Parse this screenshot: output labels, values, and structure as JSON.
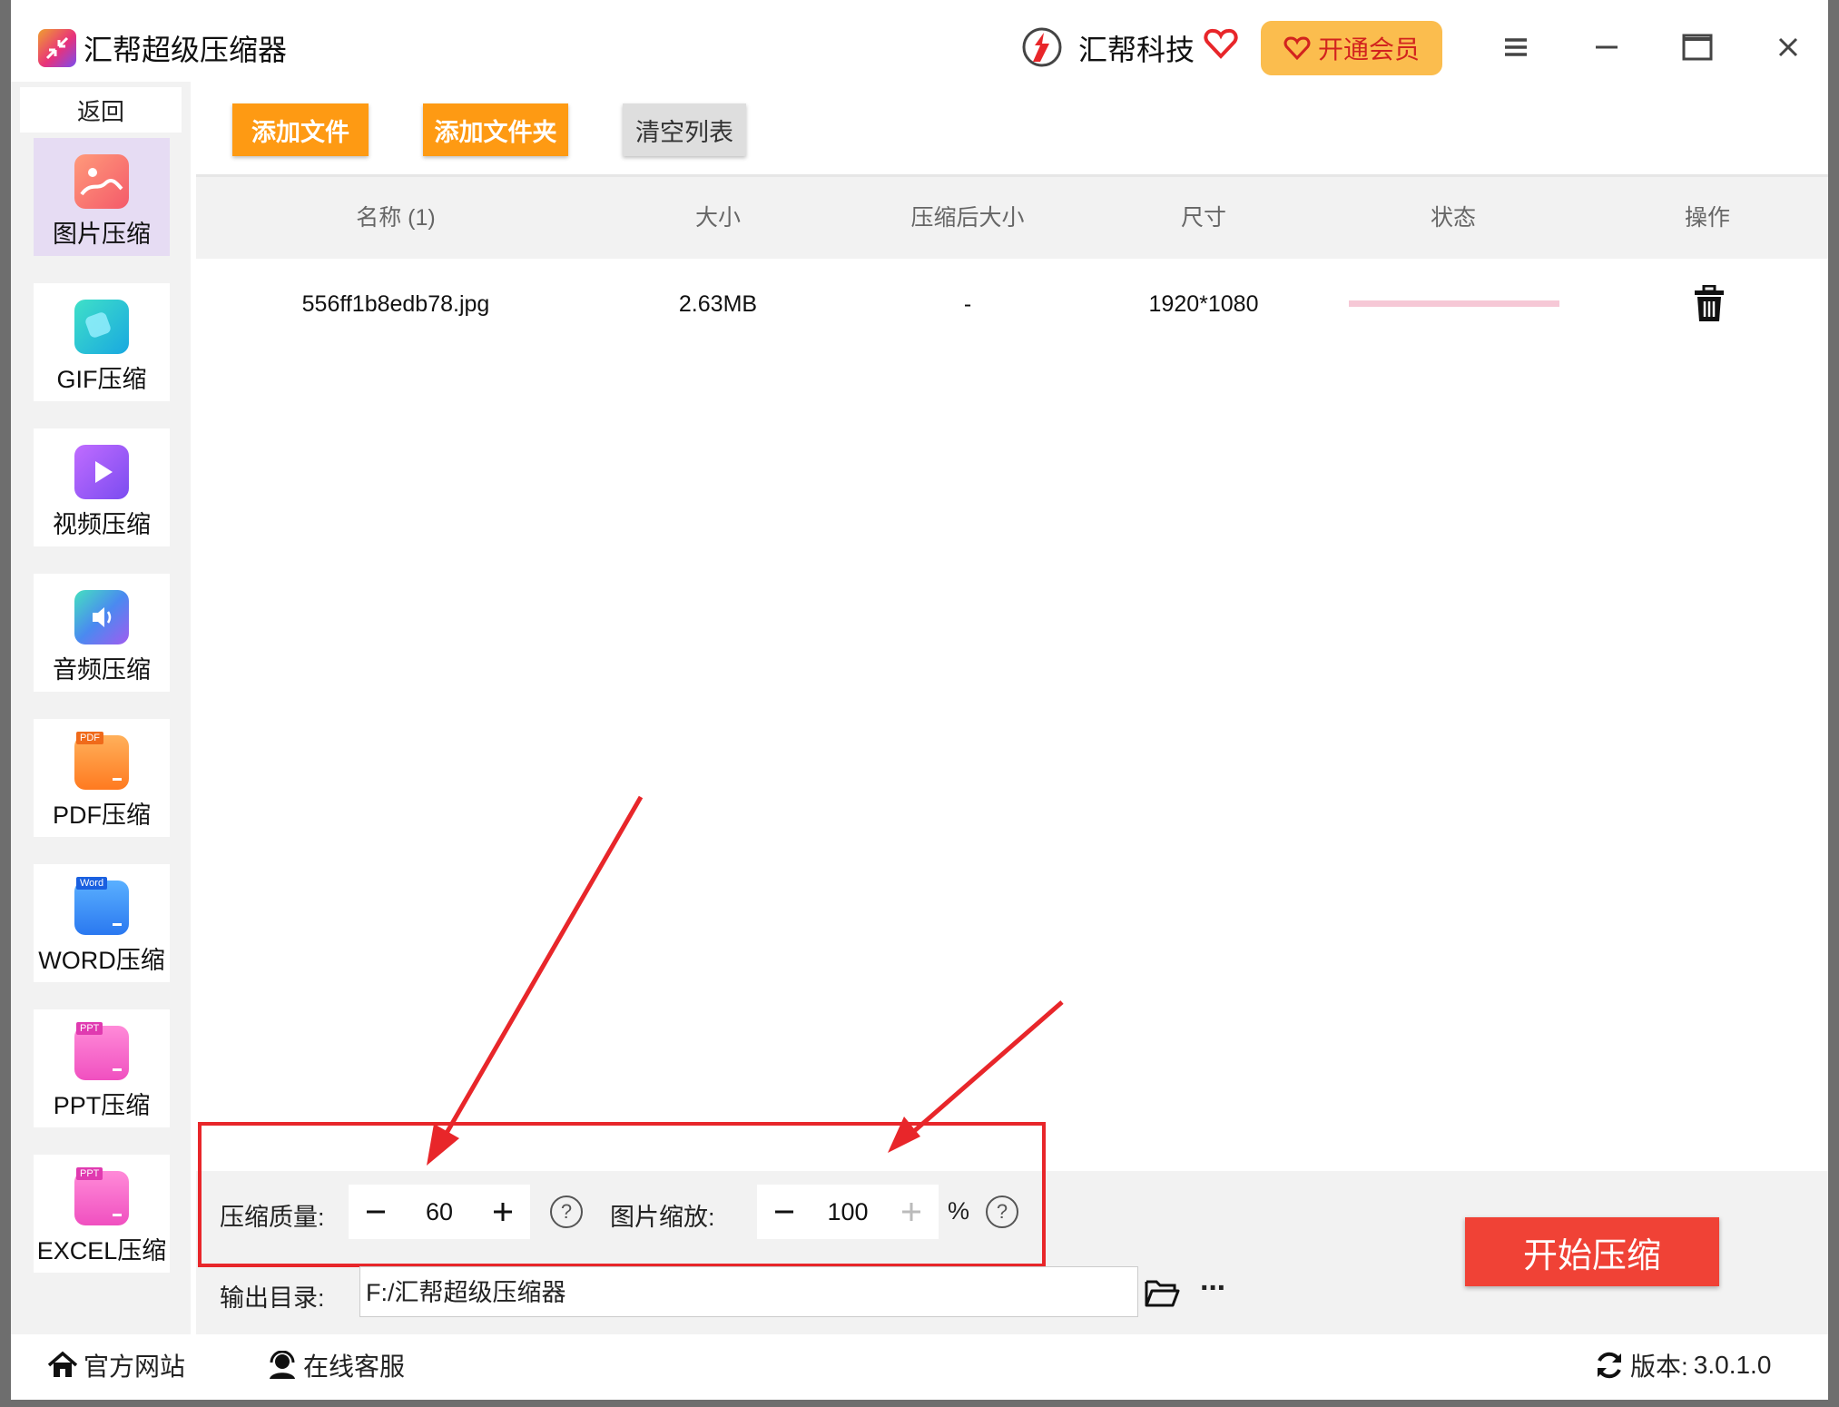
{
  "window": {
    "title": "汇帮超级压缩器",
    "brand": "汇帮科技",
    "vip_label": "开通会员"
  },
  "sidebar": {
    "back_label": "返回",
    "items": [
      {
        "label": "图片压缩",
        "icon": "image-icon",
        "active": true
      },
      {
        "label": "GIF压缩",
        "icon": "gif-icon"
      },
      {
        "label": "视频压缩",
        "icon": "video-icon"
      },
      {
        "label": "音频压缩",
        "icon": "audio-icon"
      },
      {
        "label": "PDF压缩",
        "icon": "pdf-icon",
        "badge": "PDF"
      },
      {
        "label": "WORD压缩",
        "icon": "word-icon",
        "badge": "Word"
      },
      {
        "label": "PPT压缩",
        "icon": "ppt-icon",
        "badge": "PPT"
      },
      {
        "label": "EXCEL压缩",
        "icon": "excel-icon",
        "badge": "PPT"
      }
    ]
  },
  "toolbar": {
    "add_file": "添加文件",
    "add_folder": "添加文件夹",
    "clear_list": "清空列表"
  },
  "table": {
    "headers": [
      "名称 (1)",
      "大小",
      "压缩后大小",
      "尺寸",
      "状态",
      "操作"
    ],
    "rows": [
      {
        "name": "556ff1b8edb78.jpg",
        "size": "2.63MB",
        "compressed": "-",
        "dimensions": "1920*1080",
        "progress": 0
      }
    ]
  },
  "settings": {
    "quality_label": "压缩质量:",
    "quality_value": "60",
    "scale_label": "图片缩放:",
    "scale_value": "100",
    "scale_unit": "%",
    "help_glyph": "?",
    "output_label": "输出目录:",
    "output_path": "F:/汇帮超级压缩器",
    "more_glyph": "···",
    "start_label": "开始压缩"
  },
  "footer": {
    "website": "官方网站",
    "support": "在线客服",
    "version_label": "版本:",
    "version": "3.0.1.0"
  },
  "colors": {
    "orange": "#fe9a13",
    "start_red": "#f04236",
    "highlight_red": "#e8262a",
    "vip_yellow": "#fbbd4e",
    "progress_pink": "#f6c8d6"
  }
}
